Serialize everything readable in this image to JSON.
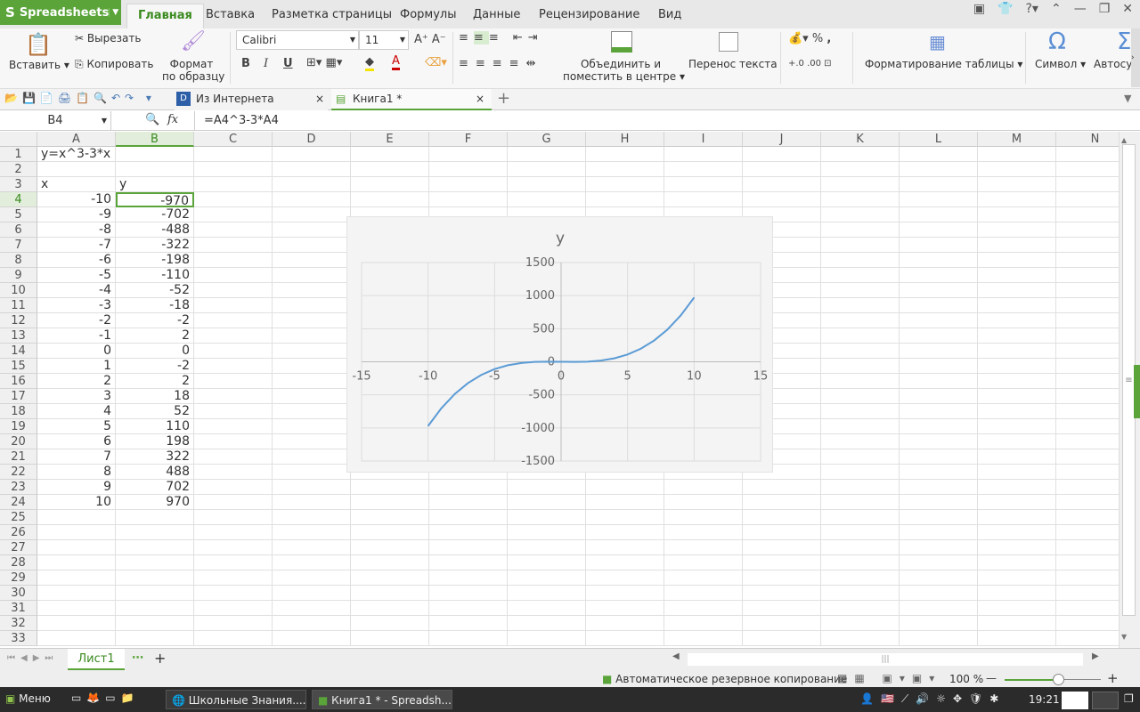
{
  "app": {
    "name": "Spreadsheets"
  },
  "menu_tabs": [
    "Главная",
    "Вставка",
    "Разметка страницы",
    "Формулы",
    "Данные",
    "Рецензирование",
    "Вид"
  ],
  "ribbon": {
    "paste": "Вставить",
    "cut": "Вырезать",
    "copy": "Копировать",
    "format_painter_1": "Формат",
    "format_painter_2": "по образцу",
    "font": "Calibri",
    "font_size": "11",
    "bold": "B",
    "italic": "I",
    "underline": "U",
    "merge_1": "Объединить и",
    "merge_2": "поместить в центре",
    "wrap": "Перенос текста",
    "percent": "%",
    "comma": ",",
    "table_format": "Форматирование таблицы",
    "symbol": "Символ",
    "autosum": "Автосу",
    "symbol_glyph": "Ω",
    "sum_glyph": "Σ"
  },
  "doc_tabs": [
    {
      "label": "Из Интернета"
    },
    {
      "label": "Книга1 *"
    }
  ],
  "formula_bar": {
    "name_box": "B4",
    "fx": "fx",
    "formula": "=A4^3-3*A4"
  },
  "columns": [
    "A",
    "B",
    "C",
    "D",
    "E",
    "F",
    "G",
    "H",
    "I",
    "J",
    "K",
    "L",
    "M",
    "N"
  ],
  "rows": [
    {
      "n": "1",
      "a": "y=x^3-3*x",
      "b": ""
    },
    {
      "n": "2",
      "a": "",
      "b": ""
    },
    {
      "n": "3",
      "a": "x",
      "b": "y"
    },
    {
      "n": "4",
      "a": "-10",
      "b": "-970"
    },
    {
      "n": "5",
      "a": "-9",
      "b": "-702"
    },
    {
      "n": "6",
      "a": "-8",
      "b": "-488"
    },
    {
      "n": "7",
      "a": "-7",
      "b": "-322"
    },
    {
      "n": "8",
      "a": "-6",
      "b": "-198"
    },
    {
      "n": "9",
      "a": "-5",
      "b": "-110"
    },
    {
      "n": "10",
      "a": "-4",
      "b": "-52"
    },
    {
      "n": "11",
      "a": "-3",
      "b": "-18"
    },
    {
      "n": "12",
      "a": "-2",
      "b": "-2"
    },
    {
      "n": "13",
      "a": "-1",
      "b": "2"
    },
    {
      "n": "14",
      "a": "0",
      "b": "0"
    },
    {
      "n": "15",
      "a": "1",
      "b": "-2"
    },
    {
      "n": "16",
      "a": "2",
      "b": "2"
    },
    {
      "n": "17",
      "a": "3",
      "b": "18"
    },
    {
      "n": "18",
      "a": "4",
      "b": "52"
    },
    {
      "n": "19",
      "a": "5",
      "b": "110"
    },
    {
      "n": "20",
      "a": "6",
      "b": "198"
    },
    {
      "n": "21",
      "a": "7",
      "b": "322"
    },
    {
      "n": "22",
      "a": "8",
      "b": "488"
    },
    {
      "n": "23",
      "a": "9",
      "b": "702"
    },
    {
      "n": "24",
      "a": "10",
      "b": "970"
    },
    {
      "n": "25",
      "a": "",
      "b": ""
    },
    {
      "n": "26",
      "a": "",
      "b": ""
    },
    {
      "n": "27",
      "a": "",
      "b": ""
    },
    {
      "n": "28",
      "a": "",
      "b": ""
    },
    {
      "n": "29",
      "a": "",
      "b": ""
    },
    {
      "n": "30",
      "a": "",
      "b": ""
    },
    {
      "n": "31",
      "a": "",
      "b": ""
    },
    {
      "n": "32",
      "a": "",
      "b": ""
    },
    {
      "n": "33",
      "a": "",
      "b": ""
    }
  ],
  "chart_data": {
    "type": "scatter",
    "title": "y",
    "x": [
      -10,
      -9,
      -8,
      -7,
      -6,
      -5,
      -4,
      -3,
      -2,
      -1,
      0,
      1,
      2,
      3,
      4,
      5,
      6,
      7,
      8,
      9,
      10
    ],
    "y": [
      -970,
      -702,
      -488,
      -322,
      -198,
      -110,
      -52,
      -18,
      -2,
      2,
      0,
      -2,
      2,
      18,
      52,
      110,
      198,
      322,
      488,
      702,
      970
    ],
    "xlim": [
      -15,
      15
    ],
    "ylim": [
      -1500,
      1500
    ],
    "xticks": [
      "-15",
      "-10",
      "-5",
      "0",
      "5",
      "10",
      "15"
    ],
    "yticks": [
      "1500",
      "1000",
      "500",
      "0",
      "-500",
      "-1000",
      "-1500"
    ],
    "line_color": "#5b9bd5",
    "grid": true
  },
  "sheet": {
    "name": "Лист1"
  },
  "status": {
    "backup": "Автоматическое резервное копирование",
    "zoom": "100 %"
  },
  "taskbar": {
    "menu": "Меню",
    "win1": "Школьные Знания....",
    "win2": "Книга1 * - Spreadsh...",
    "time": "19:21"
  }
}
